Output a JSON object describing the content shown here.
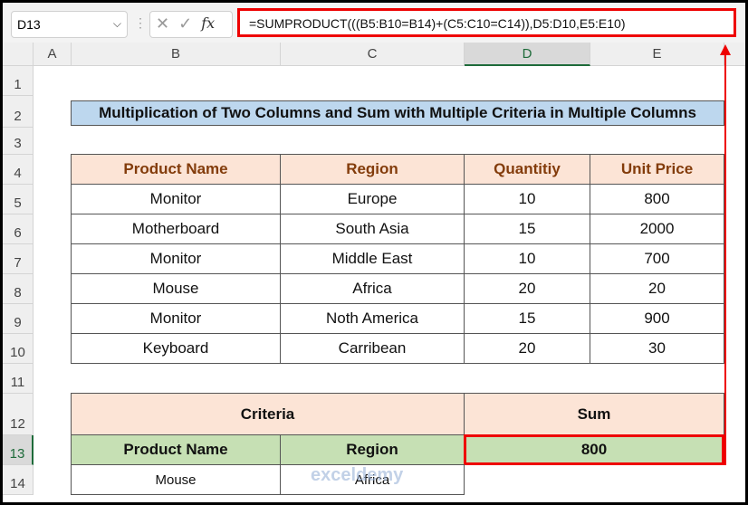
{
  "name_box": "D13",
  "formula": "=SUMPRODUCT(((B5:B10=B14)+(C5:C10=C14)),D5:D10,E5:E10)",
  "icons": {
    "cancel": "✕",
    "enter": "✓",
    "fx": "fx"
  },
  "columns": [
    "A",
    "B",
    "C",
    "D",
    "E"
  ],
  "rows": [
    "1",
    "2",
    "3",
    "4",
    "5",
    "6",
    "7",
    "8",
    "9",
    "10",
    "11",
    "12",
    "13",
    "14"
  ],
  "title": "Multiplication of Two Columns and Sum with Multiple Criteria in Multiple Columns",
  "table": {
    "headers": [
      "Product Name",
      "Region",
      "Quantitiy",
      "Unit Price"
    ],
    "rows": [
      [
        "Monitor",
        "Europe",
        "10",
        "800"
      ],
      [
        "Motherboard",
        "South Asia",
        "15",
        "2000"
      ],
      [
        "Monitor",
        "Middle East",
        "10",
        "700"
      ],
      [
        "Mouse",
        "Africa",
        "20",
        "20"
      ],
      [
        "Monitor",
        "Noth America",
        "15",
        "900"
      ],
      [
        "Keyboard",
        "Carribean",
        "20",
        "30"
      ]
    ]
  },
  "criteria": {
    "label": "Criteria",
    "sum_label": "Sum",
    "col1": "Product Name",
    "col2": "Region",
    "sum_value": "800",
    "val1": "Mouse",
    "val2": "Africa"
  },
  "watermark": "exceldemy",
  "accent": "#e00000"
}
